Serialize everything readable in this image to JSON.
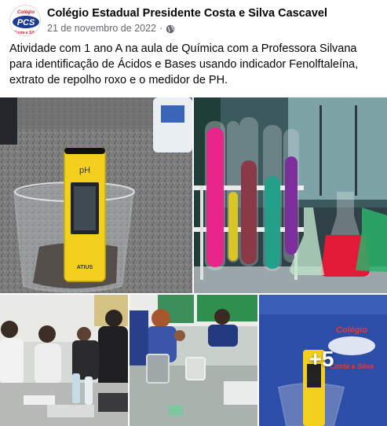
{
  "post": {
    "page_name": "Colégio Estadual Presidente Costa e Silva Cascavel",
    "date": "21 de novembro de 2022",
    "separator": "·",
    "privacy_icon": "globe-icon",
    "caption": "Atividade com 1 ano A na aula de Química com a Professora Silvana para identificação de Ácidos e Bases usando indicador Fenolftaleína, extrato de repolho roxo e o medidor de PH."
  },
  "logo": {
    "top_text": "Colégio",
    "initials": "PCS",
    "bottom_text": "Costa e Silva"
  },
  "photos": {
    "meter_label": "pH",
    "meter_brand": "ATIUS",
    "more_count": "+5",
    "shirt_text_top": "Colégio",
    "shirt_text_bottom": "Costa e Silva"
  },
  "colors": {
    "text": "#050505",
    "secondary_text": "#65676b",
    "logo_red": "#d41f27",
    "logo_blue": "#1a3b8f",
    "ph_meter_yellow": "#f2d01d",
    "shirt_blue": "#2c4da8",
    "solution_magenta": "#e8258a",
    "solution_red": "#e01a37",
    "solution_green": "#2bb36a"
  }
}
